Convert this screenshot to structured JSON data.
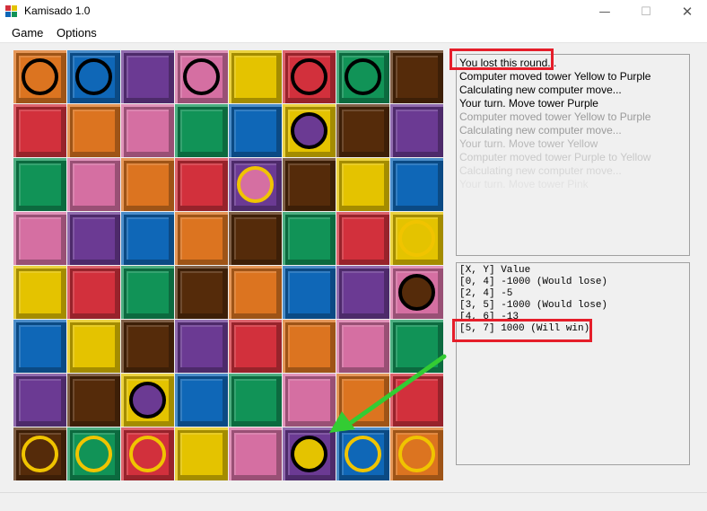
{
  "window": {
    "title": "Kamisado 1.0"
  },
  "controls": {
    "minimize": "—",
    "maximize": "☐",
    "close": "✕"
  },
  "menu": {
    "game": "Game",
    "options": "Options"
  },
  "colors": {
    "orange": "#dc7420",
    "blue": "#0f67b7",
    "purple": "#6b3a93",
    "pink": "#d56fa2",
    "yellow": "#e4c300",
    "red": "#d2303c",
    "green": "#119357",
    "brown": "#552b0a",
    "tower_ring_black": "#000000",
    "tower_ring_gold": "#f0c400",
    "highlight_red": "#e51e2a",
    "arrow_green": "#33cc33"
  },
  "board": {
    "cells": [
      [
        "orange",
        "blue",
        "purple",
        "pink",
        "yellow",
        "red",
        "green",
        "brown"
      ],
      [
        "red",
        "orange",
        "pink",
        "green",
        "blue",
        "yellow",
        "brown",
        "purple"
      ],
      [
        "green",
        "pink",
        "orange",
        "red",
        "purple",
        "brown",
        "yellow",
        "blue"
      ],
      [
        "pink",
        "purple",
        "blue",
        "orange",
        "brown",
        "green",
        "red",
        "yellow"
      ],
      [
        "yellow",
        "red",
        "green",
        "brown",
        "orange",
        "blue",
        "purple",
        "pink"
      ],
      [
        "blue",
        "yellow",
        "brown",
        "purple",
        "red",
        "orange",
        "pink",
        "green"
      ],
      [
        "purple",
        "brown",
        "yellow",
        "blue",
        "green",
        "pink",
        "orange",
        "red"
      ],
      [
        "brown",
        "green",
        "red",
        "yellow",
        "pink",
        "purple",
        "blue",
        "orange"
      ]
    ],
    "towers": [
      {
        "row": 0,
        "col": 0,
        "color": "orange",
        "ring": "black"
      },
      {
        "row": 0,
        "col": 1,
        "color": "blue",
        "ring": "black"
      },
      {
        "row": 0,
        "col": 3,
        "color": "pink",
        "ring": "black"
      },
      {
        "row": 0,
        "col": 5,
        "color": "red",
        "ring": "black"
      },
      {
        "row": 0,
        "col": 6,
        "color": "green",
        "ring": "black"
      },
      {
        "row": 1,
        "col": 5,
        "color": "purple",
        "ring": "black"
      },
      {
        "row": 2,
        "col": 4,
        "color": "pink",
        "ring": "gold"
      },
      {
        "row": 3,
        "col": 7,
        "color": "yellow",
        "ring": "gold"
      },
      {
        "row": 4,
        "col": 7,
        "color": "brown",
        "ring": "black"
      },
      {
        "row": 6,
        "col": 2,
        "color": "purple",
        "ring": "black"
      },
      {
        "row": 7,
        "col": 0,
        "color": "brown",
        "ring": "gold"
      },
      {
        "row": 7,
        "col": 1,
        "color": "green",
        "ring": "gold"
      },
      {
        "row": 7,
        "col": 2,
        "color": "red",
        "ring": "gold"
      },
      {
        "row": 7,
        "col": 5,
        "color": "yellow",
        "ring": "black"
      },
      {
        "row": 7,
        "col": 6,
        "color": "blue",
        "ring": "gold"
      },
      {
        "row": 7,
        "col": 7,
        "color": "orange",
        "ring": "gold"
      }
    ]
  },
  "log": {
    "lines": [
      {
        "text": "You lost this round...",
        "color": "#000000"
      },
      {
        "text": "Computer moved tower Yellow to Purple",
        "color": "#000000"
      },
      {
        "text": "Calculating new computer move...",
        "color": "#000000"
      },
      {
        "text": "Your turn. Move tower Purple",
        "color": "#000000"
      },
      {
        "text": "Computer moved tower Yellow to Purple",
        "color": "#9a9a9a"
      },
      {
        "text": "Calculating new computer move...",
        "color": "#9a9a9a"
      },
      {
        "text": "Your turn. Move tower Yellow",
        "color": "#b8b8b8"
      },
      {
        "text": "Computer moved tower Purple to Yellow",
        "color": "#c8c8c8"
      },
      {
        "text": "Calculating new computer move...",
        "color": "#d6d6d6"
      },
      {
        "text": "Your turn. Move tower Pink",
        "color": "#e2e2e2"
      }
    ]
  },
  "evaluation": {
    "lines": [
      "[X, Y] Value",
      "[0, 4] -1000 (Would lose)",
      "[2, 4] -5",
      "[3, 5] -1000 (Would lose)",
      "[4, 6] -13",
      "[5, 7] 1000 (Will win)"
    ]
  }
}
